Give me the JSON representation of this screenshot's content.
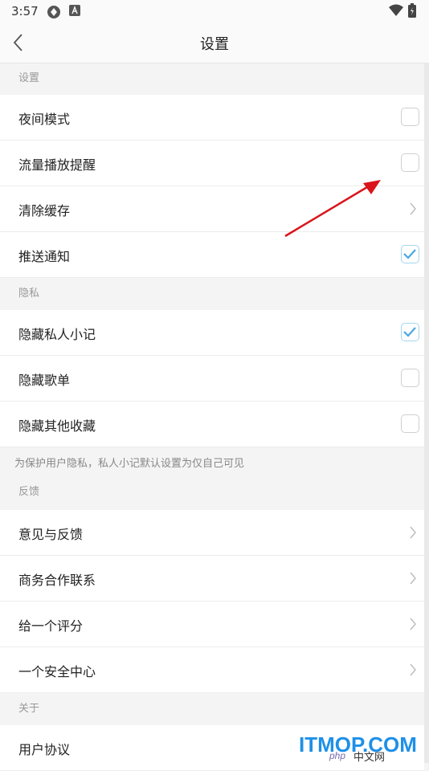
{
  "status": {
    "time": "3:57"
  },
  "header": {
    "title": "设置"
  },
  "sections": {
    "settings": {
      "title": "设置",
      "rows": [
        {
          "label": "夜间模式",
          "type": "checkbox",
          "checked": false
        },
        {
          "label": "流量播放提醒",
          "type": "checkbox",
          "checked": false
        },
        {
          "label": "清除缓存",
          "type": "link"
        },
        {
          "label": "推送通知",
          "type": "checkbox",
          "checked": true
        }
      ]
    },
    "privacy": {
      "title": "隐私",
      "rows": [
        {
          "label": "隐藏私人小记",
          "type": "checkbox",
          "checked": true
        },
        {
          "label": "隐藏歌单",
          "type": "checkbox",
          "checked": false
        },
        {
          "label": "隐藏其他收藏",
          "type": "checkbox",
          "checked": false
        }
      ],
      "note": "为保护用户隐私，私人小记默认设置为仅自己可见"
    },
    "feedback": {
      "title": "反馈",
      "rows": [
        {
          "label": "意见与反馈",
          "type": "link"
        },
        {
          "label": "商务合作联系",
          "type": "link"
        },
        {
          "label": "给一个评分",
          "type": "link"
        },
        {
          "label": "一个安全中心",
          "type": "link"
        }
      ]
    },
    "about": {
      "title": "关于",
      "rows": [
        {
          "label": "用户协议",
          "type": "link"
        }
      ]
    }
  },
  "watermark": {
    "brand": "ITMOP.COM",
    "php": "php",
    "sub": "中文网"
  },
  "colors": {
    "check": "#4aa8e0",
    "annotation_arrow": "#d9151b"
  },
  "icons": [
    "back-arrow-icon",
    "chevron-right-icon",
    "checkmark-icon",
    "wifi-icon",
    "battery-icon"
  ]
}
